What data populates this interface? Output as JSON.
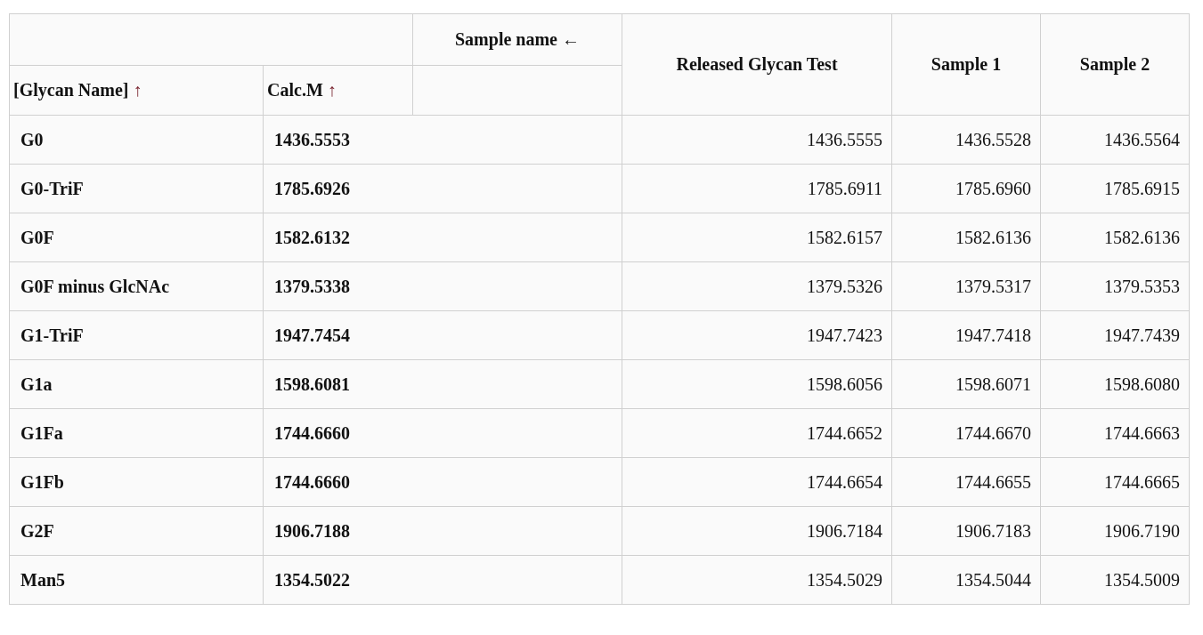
{
  "table": {
    "pivot_header": "Sample name ←",
    "row_headers": [
      {
        "label": "[Glycan Name]",
        "sort_arrow": "↑"
      },
      {
        "label": "Calc.M",
        "sort_arrow": "↑"
      }
    ],
    "sample_columns": [
      "Released Glycan Test",
      "Sample 1",
      "Sample 2"
    ],
    "rows": [
      {
        "name": "G0",
        "calc_m": "1436.5553",
        "values": [
          "1436.5555",
          "1436.5528",
          "1436.5564"
        ]
      },
      {
        "name": "G0-TriF",
        "calc_m": "1785.6926",
        "values": [
          "1785.6911",
          "1785.6960",
          "1785.6915"
        ]
      },
      {
        "name": "G0F",
        "calc_m": "1582.6132",
        "values": [
          "1582.6157",
          "1582.6136",
          "1582.6136"
        ]
      },
      {
        "name": "G0F minus GlcNAc",
        "calc_m": "1379.5338",
        "values": [
          "1379.5326",
          "1379.5317",
          "1379.5353"
        ]
      },
      {
        "name": "G1-TriF",
        "calc_m": "1947.7454",
        "values": [
          "1947.7423",
          "1947.7418",
          "1947.7439"
        ]
      },
      {
        "name": "G1a",
        "calc_m": "1598.6081",
        "values": [
          "1598.6056",
          "1598.6071",
          "1598.6080"
        ]
      },
      {
        "name": "G1Fa",
        "calc_m": "1744.6660",
        "values": [
          "1744.6652",
          "1744.6670",
          "1744.6663"
        ]
      },
      {
        "name": "G1Fb",
        "calc_m": "1744.6660",
        "values": [
          "1744.6654",
          "1744.6655",
          "1744.6665"
        ]
      },
      {
        "name": "G2F",
        "calc_m": "1906.7188",
        "values": [
          "1906.7184",
          "1906.7183",
          "1906.7190"
        ]
      },
      {
        "name": "Man5",
        "calc_m": "1354.5022",
        "values": [
          "1354.5029",
          "1354.5044",
          "1354.5009"
        ]
      }
    ]
  }
}
